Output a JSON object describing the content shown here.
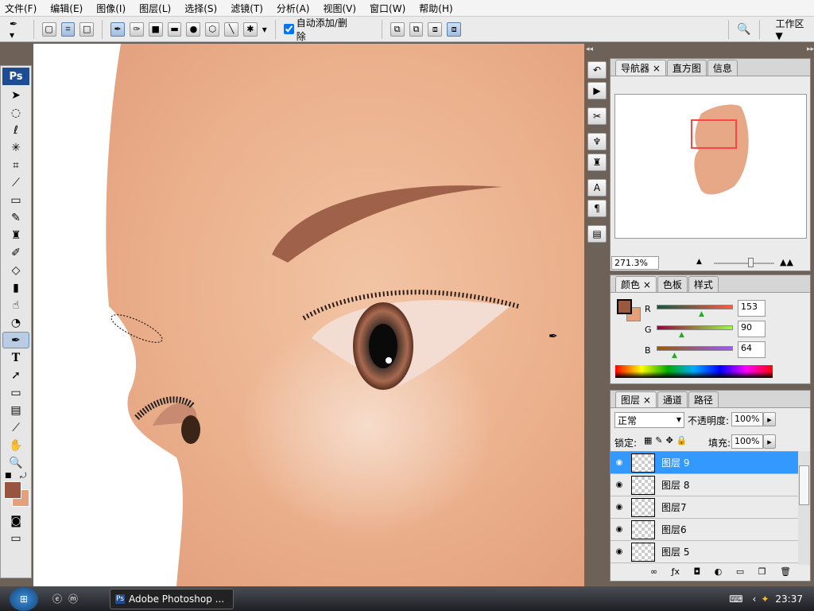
{
  "menu": [
    "文件(F)",
    "编辑(E)",
    "图像(I)",
    "图层(L)",
    "选择(S)",
    "滤镜(T)",
    "分析(A)",
    "视图(V)",
    "窗口(W)",
    "帮助(H)"
  ],
  "options": {
    "auto_add_delete": "自动添加/删除",
    "auto_add_checked": true,
    "workspace": "工作区 ▼"
  },
  "toolbox": {
    "logo": "Ps",
    "active_tool": "pen",
    "foreground": "#99543f",
    "background": "#e3a07b"
  },
  "navigator": {
    "tabs": [
      "导航器",
      "直方图",
      "信息"
    ],
    "zoom": "271.3%"
  },
  "color": {
    "tabs": [
      "颜色",
      "色板",
      "样式"
    ],
    "labels": [
      "R",
      "G",
      "B"
    ],
    "values": [
      "153",
      "90",
      "64"
    ],
    "fg": "#995a40",
    "bg": "#e3a07b"
  },
  "layers": {
    "tabs": [
      "图层",
      "通道",
      "路径"
    ],
    "blend_mode": "正常",
    "opacity_label": "不透明度:",
    "opacity": "100%",
    "lock_label": "锁定:",
    "fill_label": "填充:",
    "fill": "100%",
    "items": [
      {
        "name": "图层 9",
        "selected": true
      },
      {
        "name": "图层 8"
      },
      {
        "name": "图层7"
      },
      {
        "name": "图层6"
      },
      {
        "name": "图层 5"
      }
    ]
  },
  "taskbar": {
    "app": "Adobe Photoshop ...",
    "time": "23:37"
  }
}
